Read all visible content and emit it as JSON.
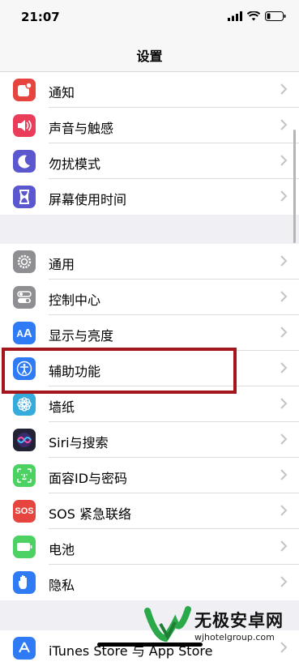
{
  "status_bar": {
    "time": "21:07"
  },
  "nav": {
    "title": "设置"
  },
  "group1": [
    {
      "label": "通知",
      "icon": "notifications-icon",
      "color": "#e6443f"
    },
    {
      "label": "声音与触感",
      "icon": "sounds-icon",
      "color": "#ea3d5a"
    },
    {
      "label": "勿扰模式",
      "icon": "moon-icon",
      "color": "#5b57cf"
    },
    {
      "label": "屏幕使用时间",
      "icon": "hourglass-icon",
      "color": "#5b57cf"
    }
  ],
  "group2": [
    {
      "label": "通用",
      "icon": "gear-icon",
      "color": "#8e8e93"
    },
    {
      "label": "控制中心",
      "icon": "switches-icon",
      "color": "#8e8e93"
    },
    {
      "label": "显示与亮度",
      "icon": "text-size-icon",
      "color": "#2f7bf5"
    },
    {
      "label": "辅助功能",
      "icon": "accessibility-icon",
      "color": "#2f7bf5"
    },
    {
      "label": "墙纸",
      "icon": "flower-icon",
      "color": "#35aadc"
    },
    {
      "label": "Siri与搜索",
      "icon": "siri-icon",
      "color": "#222235"
    },
    {
      "label": "面容ID与密码",
      "icon": "face-id-icon",
      "color": "#4cd263"
    },
    {
      "label": "SOS 紧急联络",
      "icon": "sos-icon",
      "color": "#e6443f",
      "icon_text": "SOS"
    },
    {
      "label": "电池",
      "icon": "battery-icon",
      "color": "#4cd263"
    },
    {
      "label": "隐私",
      "icon": "hand-icon",
      "color": "#2f7bf5"
    }
  ],
  "group3": [
    {
      "label": "iTunes Store 与 App Store",
      "icon": "app-store-icon",
      "color": "#2f7bf5"
    }
  ],
  "watermark": {
    "title": "无极安卓网",
    "url": "wjhotelgroup.com"
  }
}
